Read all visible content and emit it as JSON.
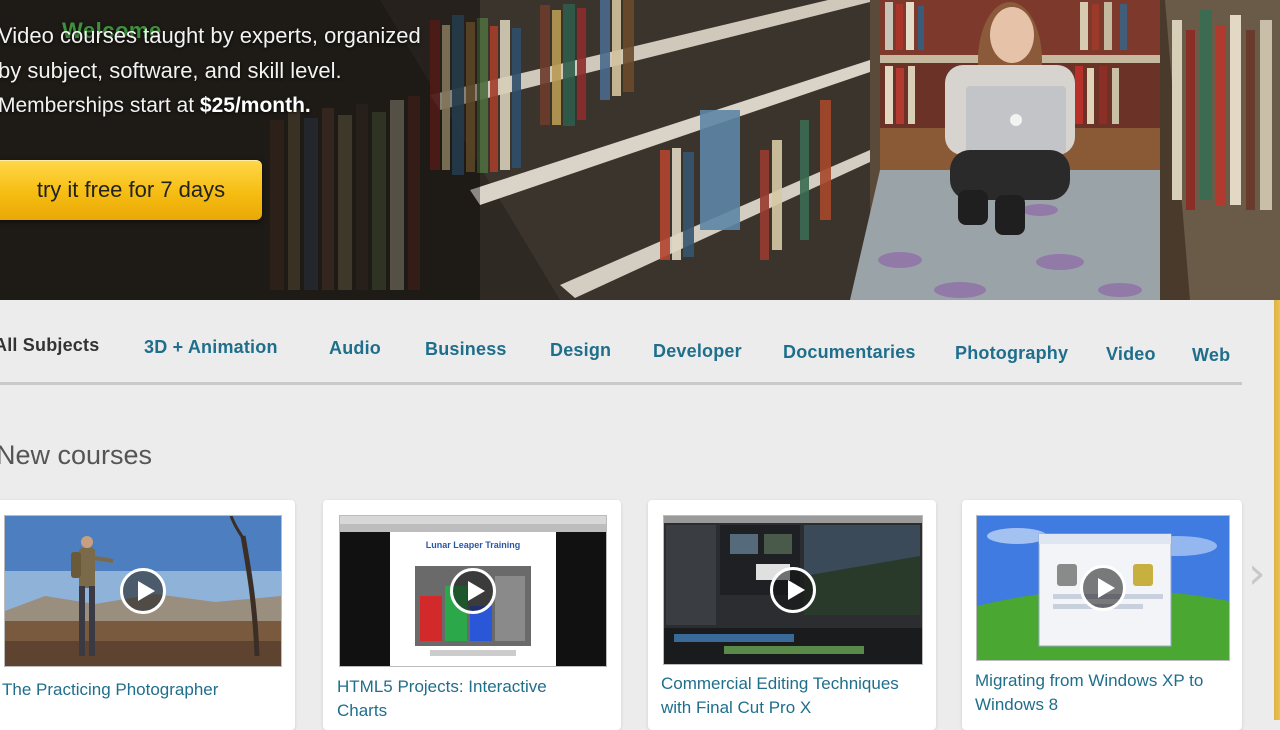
{
  "hero": {
    "line1": "Video courses taught by experts, organized",
    "line2": "by subject, software, and skill level.",
    "line3_prefix": "Memberships start at ",
    "line3_price": "$25/month.",
    "logo_text": "Welcome",
    "cta_label": "try it free for 7 days"
  },
  "nav": {
    "items": [
      {
        "label": "All Subjects"
      },
      {
        "label": "3D + Animation"
      },
      {
        "label": "Audio"
      },
      {
        "label": "Business"
      },
      {
        "label": "Design"
      },
      {
        "label": "Developer"
      },
      {
        "label": "Documentaries"
      },
      {
        "label": "Photography"
      },
      {
        "label": "Video"
      },
      {
        "label": "Web"
      }
    ]
  },
  "courses": {
    "heading": "New courses",
    "items": [
      {
        "title_line1": "The Practicing Photographer",
        "title_line2": ""
      },
      {
        "title_line1": "HTML5 Projects: Interactive",
        "title_line2": "Charts"
      },
      {
        "title_line1": "Commercial Editing Techniques",
        "title_line2": "with Final Cut Pro X"
      },
      {
        "title_line1": "Migrating from Windows XP to",
        "title_line2": "Windows 8"
      }
    ],
    "thumb2_heading": "Lunar Leaper Training"
  },
  "icons": {
    "play": "play-icon",
    "next": "chevron-right-icon"
  },
  "colors": {
    "link": "#1f6e8c",
    "cta": "#f6bd12",
    "active_nav": "#333333"
  }
}
